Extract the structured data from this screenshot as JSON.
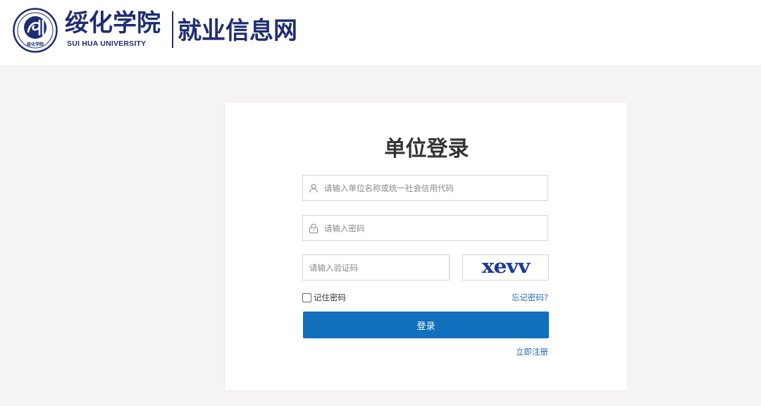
{
  "header": {
    "brand_cn": "绥化学院",
    "brand_en": "SUI HUA UNIVERSITY",
    "seal_text": "绥化学院",
    "site_name": "就业信息网"
  },
  "login": {
    "title": "单位登录",
    "username_placeholder": "请输入单位名称或统一社会信用代码",
    "password_placeholder": "请输入密码",
    "captcha_placeholder": "请输入验证码",
    "captcha_text": "xevv",
    "remember_label": "记住密码",
    "forgot_label": "忘记密码?",
    "submit_label": "登录",
    "register_label": "立即注册"
  },
  "colors": {
    "brand": "#1f2d73",
    "primary": "#116fbd",
    "link": "#1e6bb8",
    "background": "#f5f4f2"
  },
  "icons": {
    "username": "user-icon",
    "password": "lock-icon",
    "logo": "university-seal-icon"
  }
}
